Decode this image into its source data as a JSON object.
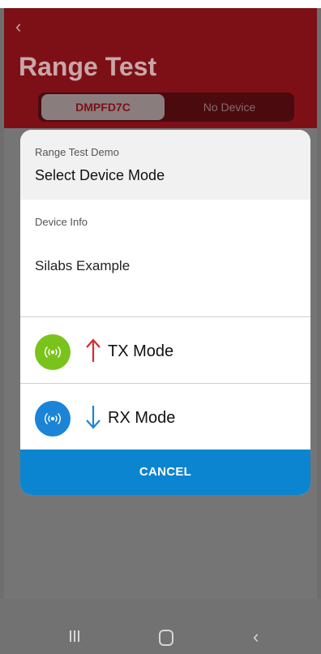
{
  "header": {
    "back_glyph": "‹",
    "title": "Range Test",
    "segments": [
      "DMPFD7C",
      "No Device"
    ]
  },
  "dialog": {
    "subtitle": "Range Test Demo",
    "title": "Select Device Mode",
    "info_label": "Device Info",
    "info_value": "Silabs Example",
    "modes": [
      {
        "label": "TX Mode",
        "icon": "antenna-icon",
        "arrow": "arrow-up",
        "color": "#7ac31c",
        "arrow_color": "#d62b2b"
      },
      {
        "label": "RX Mode",
        "icon": "antenna-icon",
        "arrow": "arrow-down",
        "color": "#1b84d6",
        "arrow_color": "#1b84d6"
      }
    ],
    "cancel_label": "CANCEL",
    "cancel_color": "#0b85d0"
  },
  "colors": {
    "brand": "#7d1017",
    "overlay": "#757575"
  }
}
